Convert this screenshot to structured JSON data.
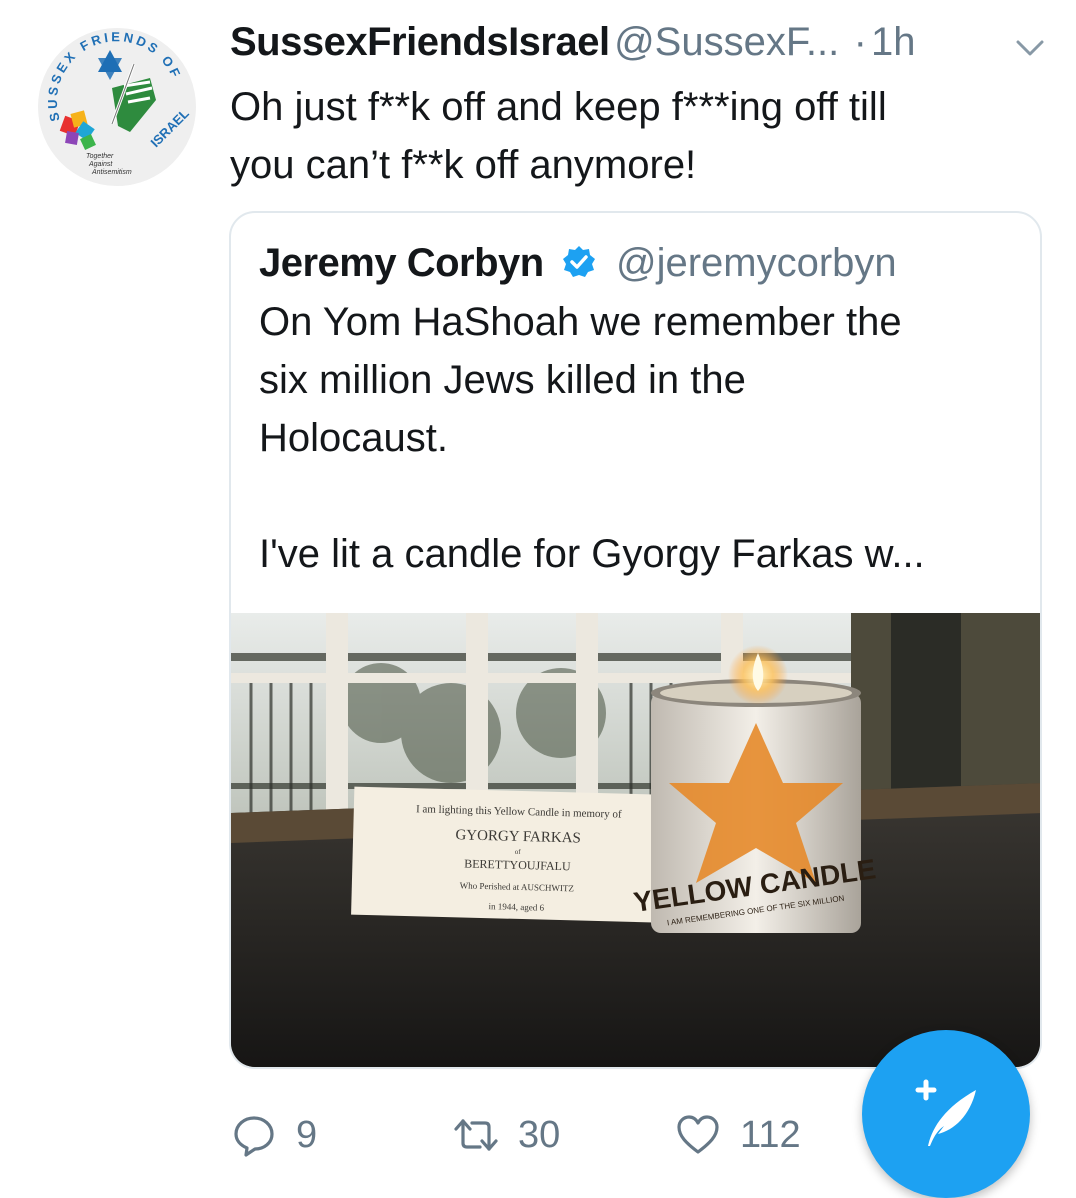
{
  "tweet": {
    "author_name": "SussexFriendsIsrael",
    "author_handle": "@SussexF...",
    "time": "1h",
    "separator": "·",
    "text_line1": "Oh just f**k off and keep f***ing off till",
    "text_line2": "you can’t f**k off anymore!",
    "avatar": {
      "ring_text": "SUSSEX FRIENDS OF",
      "ring_text_end": "ISRAEL",
      "tagline_1": "Together",
      "tagline_2": "Against",
      "tagline_3": "Antisemitism"
    }
  },
  "quoted": {
    "author_name": "Jeremy Corbyn",
    "author_handle": "@jeremycorbyn",
    "verified": true,
    "text_line1": "On Yom HaShoah we remember the",
    "text_line2": "six million Jews killed in the",
    "text_line3": "Holocaust.",
    "text_line4": "I've lit a candle for Gyorgy Farkas w...",
    "image": {
      "card_line1": "I am lighting this Yellow Candle in memory of",
      "card_line2": "GYORGY FARKAS",
      "card_line3": "of",
      "card_line4": "BERETTYOUJFALU",
      "card_line5": "Who Perished at AUSCHWITZ",
      "card_line6": "in 1944, aged 6",
      "candle_brand": "YELLOW CANDLE",
      "candle_sub": "I AM REMEMBERING ONE OF THE SIX MILLION"
    }
  },
  "actions": {
    "reply_count": "9",
    "retweet_count": "30",
    "like_count": "112"
  },
  "colors": {
    "accent": "#1da1f2",
    "secondary_text": "#657786",
    "border": "#e1e8ed"
  },
  "icons": [
    "chevron-down-icon",
    "verified-badge-icon",
    "reply-icon",
    "retweet-icon",
    "like-icon",
    "compose-tweet-icon"
  ]
}
